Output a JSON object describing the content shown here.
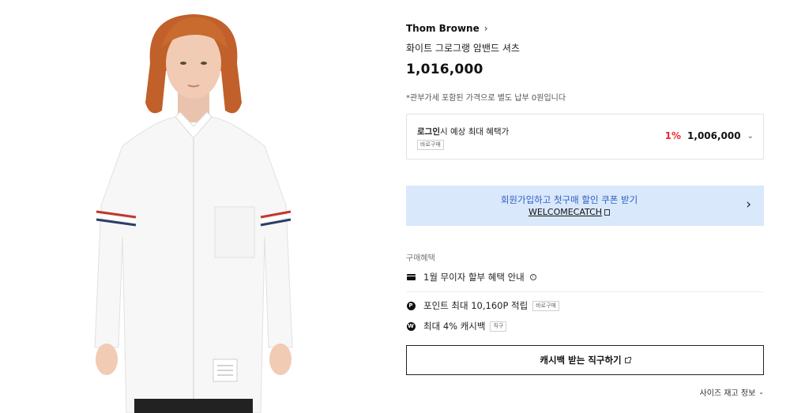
{
  "product": {
    "image_alt": "Model wearing white shirt with tricolor armbands",
    "brand": "Thom Browne",
    "name": "화이트 그로그랭 암밴드 셔츠",
    "price": "1,016,000",
    "tax_note": "*관부가세 포함된 가격으로 별도 납부 0원입니다"
  },
  "login_benefit": {
    "label_bold": "로그인",
    "label_rest": "시 예상 최대 혜택가",
    "badge": "바로구매",
    "discount_pct": "1%",
    "discounted_price": "1,006,000"
  },
  "coupon": {
    "line1": "회원가입하고 첫구매 할인 쿠폰 받기",
    "code": "WELCOMECATCH"
  },
  "benefits": {
    "title": "구매혜택",
    "installment": "1월 무이자 할부 혜택 안내",
    "points": "포인트 최대 10,160P 적립",
    "points_badge": "바로구매",
    "cashback": "최대 4% 캐시백",
    "cashback_badge": "직구"
  },
  "actions": {
    "cashback_button": "캐시백 받는 직구하기",
    "size_stock": "사이즈 재고 정보"
  },
  "icons": {
    "brand_chevron": "chevron-right-icon",
    "dropdown": "chevron-down-icon",
    "copy": "copy-icon",
    "banner_arrow": "chevron-right-icon",
    "card": "credit-card-icon",
    "point": "point-icon",
    "cashback": "cashback-icon",
    "info": "info-icon",
    "external": "external-link-icon"
  },
  "colors": {
    "accent_red": "#ee2a2a",
    "banner_bg": "#d9e8fb",
    "banner_text": "#2f5ec4"
  }
}
